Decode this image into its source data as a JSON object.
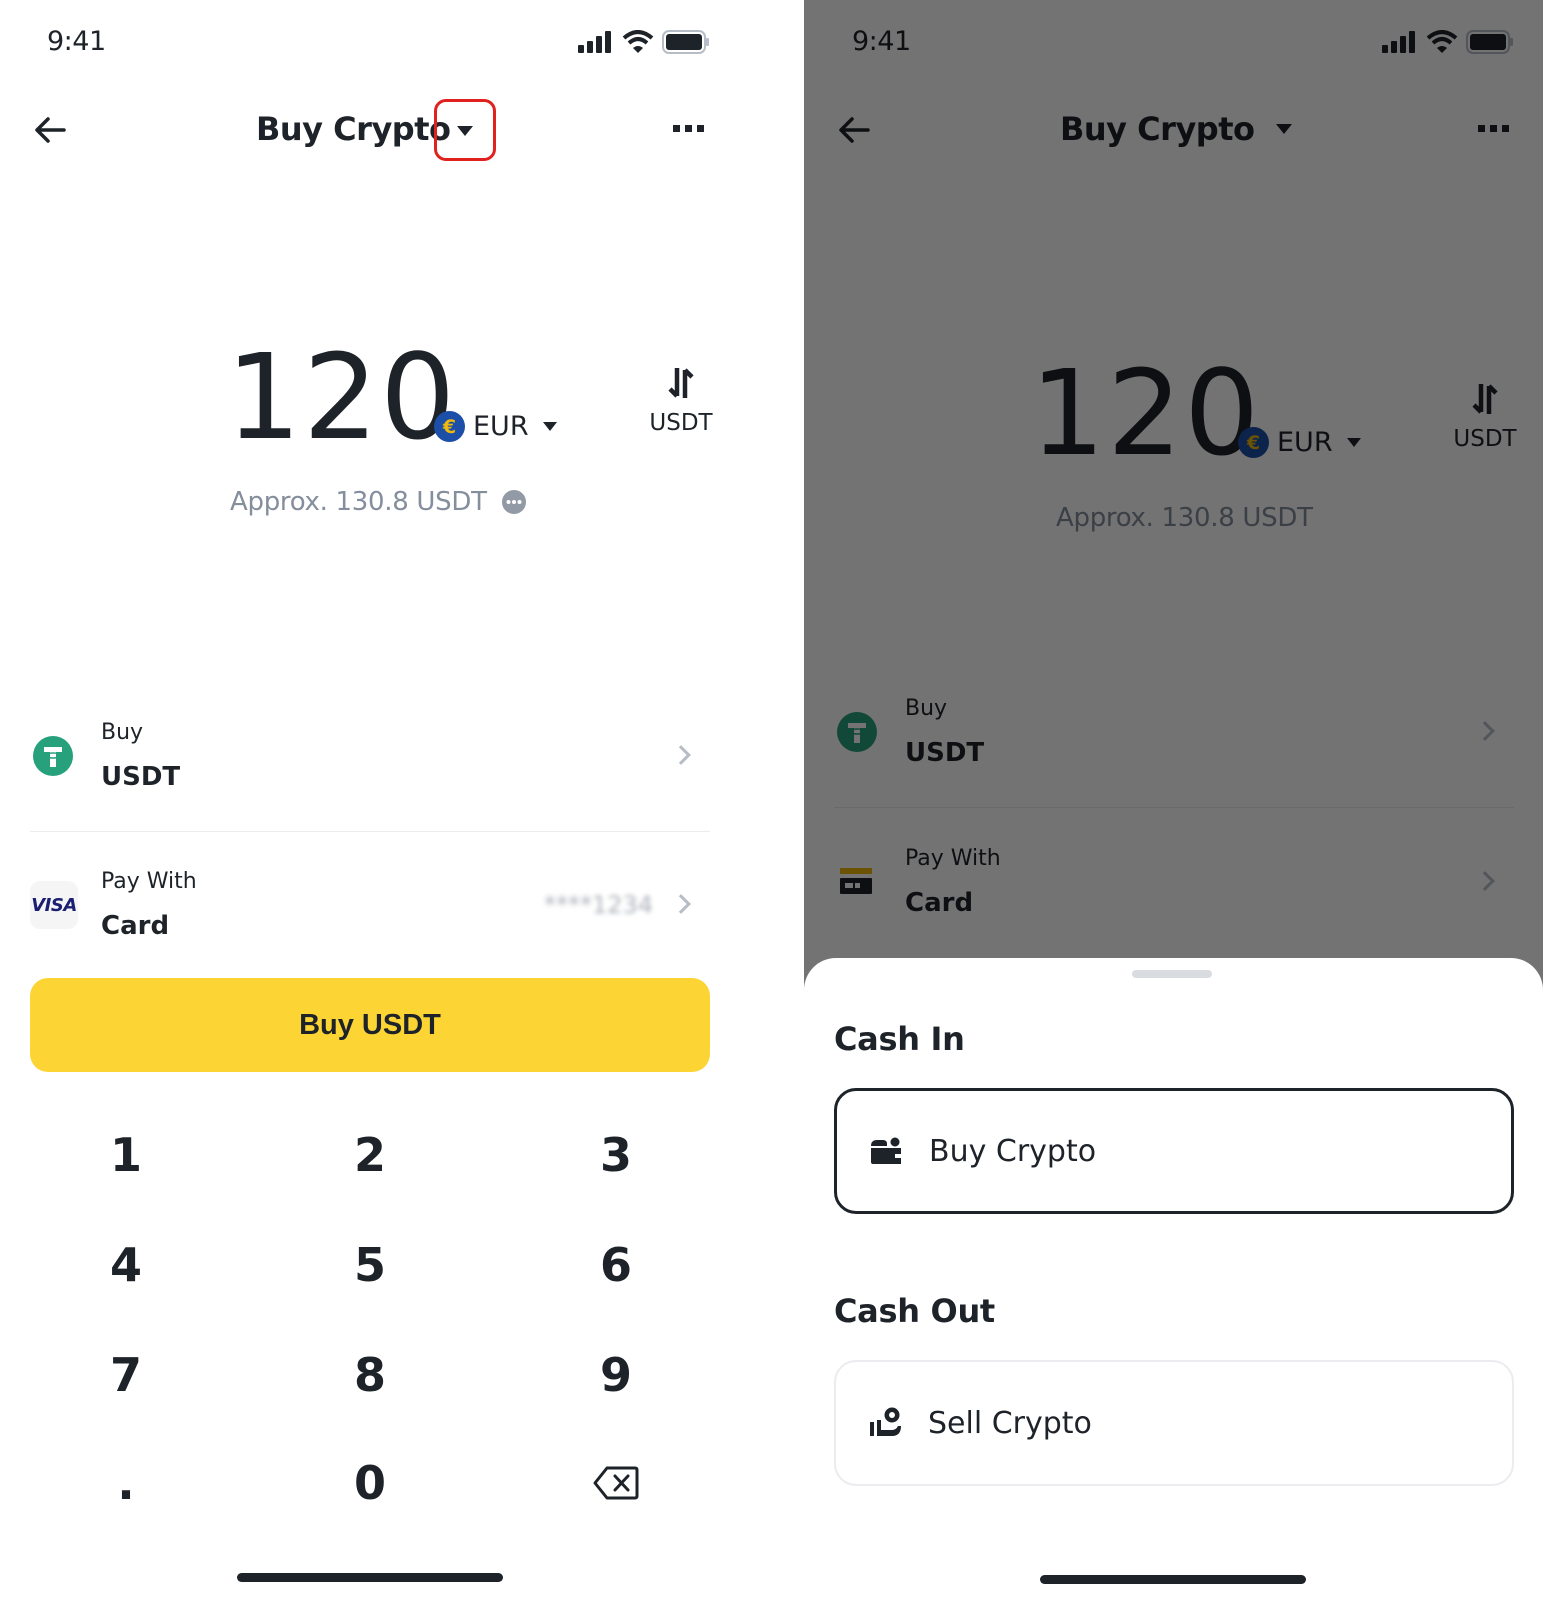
{
  "status_bar": {
    "time": "9:41",
    "icons": [
      "signal-icon",
      "wifi-icon",
      "battery-icon"
    ]
  },
  "header": {
    "back_icon": "arrow-left-icon",
    "title": "Buy Crypto",
    "title_dropdown_icon": "caret-down-icon",
    "more_icon": "more-horizontal-icon"
  },
  "amount": {
    "value": "120",
    "currency_symbol": "€",
    "currency_code": "EUR",
    "switch_target": "USDT",
    "approx": "Approx. 130.8 USDT",
    "info_icon": "more-circle-icon"
  },
  "rows": {
    "buy": {
      "label": "Buy",
      "value": "USDT",
      "icon": "tether-icon"
    },
    "pay_left": {
      "label": "Pay With",
      "value": "Card",
      "icon": "visa-icon",
      "icon_text": "VISA",
      "card_mask": "****1234"
    },
    "pay_right": {
      "label": "Pay With",
      "value": "Card",
      "icon": "credit-card-icon"
    }
  },
  "buy_button": {
    "label": "Buy USDT"
  },
  "keypad": {
    "keys": [
      "1",
      "2",
      "3",
      "4",
      "5",
      "6",
      "7",
      "8",
      "9",
      ".",
      "0"
    ],
    "backspace_icon": "backspace-icon"
  },
  "sheet": {
    "cash_in_heading": "Cash In",
    "cash_in_option": {
      "label": "Buy Crypto",
      "icon": "wallet-icon",
      "selected": true
    },
    "cash_out_heading": "Cash Out",
    "cash_out_option": {
      "label": "Sell Crypto",
      "icon": "hand-coin-icon",
      "selected": false
    }
  },
  "colors": {
    "accent_yellow": "#fcd535",
    "text_primary": "#1e2329",
    "text_secondary": "#848e9c",
    "highlight_red": "#e0211d",
    "tether_green": "#26a17b",
    "euro_blue": "#1b4fa8"
  }
}
